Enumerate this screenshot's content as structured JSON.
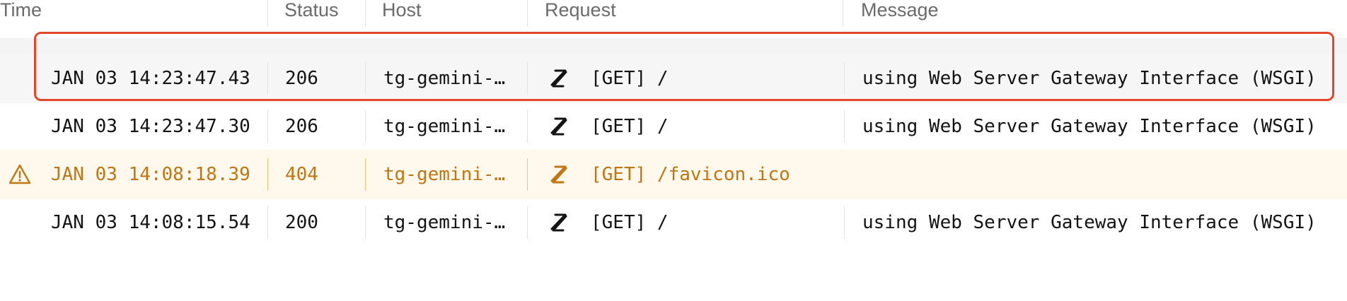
{
  "columns": {
    "time": "Time",
    "status": "Status",
    "host": "Host",
    "request": "Request",
    "message": "Message"
  },
  "icons": {
    "request": "vercel-s-logo-icon",
    "warning": "warning-triangle-icon"
  },
  "colors": {
    "warning_text": "#c07612",
    "warning_bg": "#fff8ec",
    "highlight_border": "#e2472b"
  },
  "rows": [
    {
      "time": "JAN 03 14:23:47.43",
      "status": "206",
      "host": "tg-gemini-…",
      "request": "[GET] /",
      "message": "using Web Server Gateway Interface (WSGI)",
      "highlighted": true
    },
    {
      "time": "JAN 03 14:23:47.30",
      "status": "206",
      "host": "tg-gemini-…",
      "request": "[GET] /",
      "message": "using Web Server Gateway Interface (WSGI)"
    },
    {
      "time": "JAN 03 14:08:18.39",
      "status": "404",
      "host": "tg-gemini-…",
      "request": "[GET] /favicon.ico",
      "message": "",
      "level": "warning"
    },
    {
      "time": "JAN 03 14:08:15.54",
      "status": "200",
      "host": "tg-gemini-…",
      "request": "[GET] /",
      "message": "using Web Server Gateway Interface (WSGI)"
    }
  ]
}
